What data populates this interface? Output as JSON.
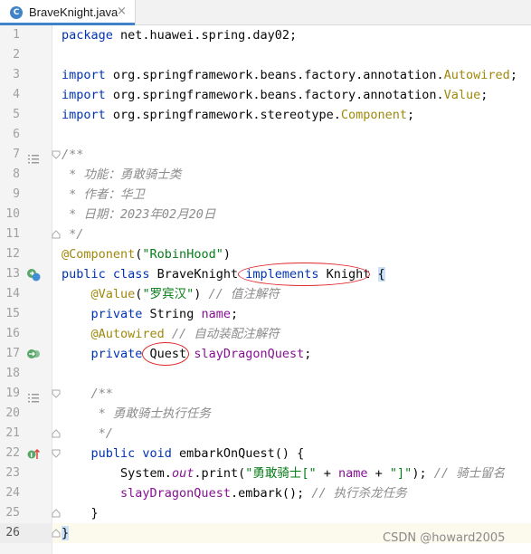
{
  "tab": {
    "title": "BraveKnight.java",
    "icon": "java-class-icon",
    "close_glyph": "×"
  },
  "line_numbers": [
    "1",
    "2",
    "3",
    "4",
    "5",
    "6",
    "7",
    "8",
    "9",
    "10",
    "11",
    "12",
    "13",
    "14",
    "15",
    "16",
    "17",
    "18",
    "19",
    "20",
    "21",
    "22",
    "23",
    "24",
    "25",
    "26"
  ],
  "code": {
    "l1_kw": "package",
    "l1_rest": " net.huawei.spring.day02;",
    "l3_kw": "import",
    "l3_pkg": " org.springframework.beans.factory.annotation.",
    "l3_cls": "Autowired",
    "l4_kw": "import",
    "l4_pkg": " org.springframework.beans.factory.annotation.",
    "l4_cls": "Value",
    "l5_kw": "import",
    "l5_pkg": " org.springframework.stereotype.",
    "l5_cls": "Component",
    "l7": "/**",
    "l8": " * 功能：勇敢骑士类",
    "l9": " * 作者：华卫",
    "l10": " * 日期：2023年02月20日",
    "l11": " */",
    "l12_ann": "@Component",
    "l12_open": "(",
    "l12_str": "\"RobinHood\"",
    "l12_close": ")",
    "l13_kw": "public class",
    "l13_name": " BraveKnight ",
    "l13_impl": "implements",
    "l13_iface": " Knight ",
    "l13_brace": "{",
    "l14_ann": "@Value",
    "l14_open": "(",
    "l14_str": "\"罗宾汉\"",
    "l14_close": ")",
    "l14_cmt": " // 值注解符",
    "l15_kw": "private",
    "l15_type": " String ",
    "l15_field": "name",
    "l15_semi": ";",
    "l16_ann": "@Autowired",
    "l16_cmt": " // 自动装配注解符",
    "l17_kw": "private",
    "l17_type": " Quest ",
    "l17_field": "slayDragonQuest",
    "l17_semi": ";",
    "l19": "/**",
    "l20": " * 勇敢骑士执行任务",
    "l21": " */",
    "l22_kw": "public void",
    "l22_rest": " embarkOnQuest() {",
    "l23_pre": "System.",
    "l23_out": "out",
    "l23_mid": ".print(",
    "l23_str1": "\"勇敢骑士[\"",
    "l23_plus1": " + ",
    "l23_field": "name",
    "l23_plus2": " + ",
    "l23_str2": "\"]\"",
    "l23_end": ");",
    "l23_cmt": " // 骑士留名",
    "l24_field": "slayDragonQuest",
    "l24_rest": ".embark();",
    "l24_cmt": " // 执行杀龙任务",
    "l25": "}",
    "l26": "}"
  },
  "gutter_icons": {
    "line13": "implemented-interface-icon",
    "line17": "bean-injection-icon",
    "line22": "implements-method-icon",
    "line7": "doc-comment-icon",
    "line19": "doc-comment-icon"
  },
  "colors": {
    "keyword": "#0033b3",
    "string": "#067d17",
    "annotation": "#9e880d",
    "field": "#871094",
    "comment": "#8c8c8c",
    "highlight_oval": "#e0262a"
  },
  "watermark": "CSDN @howard2005"
}
